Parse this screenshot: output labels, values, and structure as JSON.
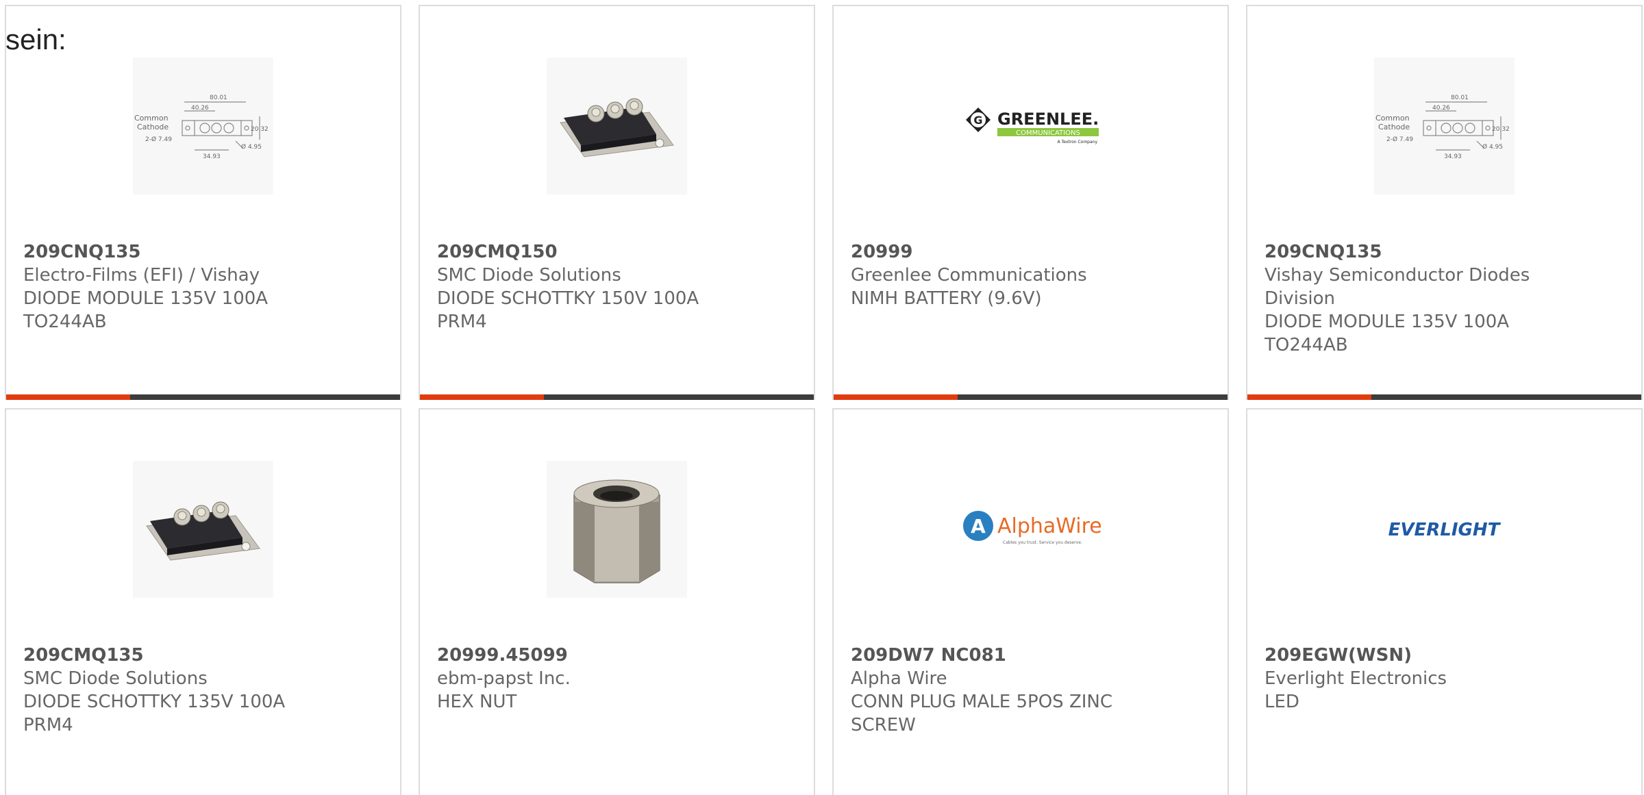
{
  "header": {
    "lead_text": "sein:"
  },
  "colors": {
    "accent": "#e03c10",
    "bar": "#3c3c3c",
    "border": "#dcdcdc",
    "text": "#666666"
  },
  "products": [
    {
      "part": "209CNQ135",
      "manufacturer": "Electro-Films (EFI) / Vishay",
      "desc1": "DIODE MODULE 135V 100A",
      "desc2": "TO244AB",
      "image": "dimension-drawing",
      "drawing": {
        "common": "Common",
        "cathode": "Cathode",
        "dim1": "80.01",
        "dim2": "40.26",
        "dim3": "20.32",
        "dim4": "2-Ø 7.49",
        "dim5": "Ø 4.95",
        "dim6": "34.93"
      }
    },
    {
      "part": "209CMQ150",
      "manufacturer": "SMC Diode Solutions",
      "desc1": "DIODE SCHOTTKY 150V 100A",
      "desc2": "PRM4",
      "image": "diode-module-photo"
    },
    {
      "part": "20999",
      "manufacturer": "Greenlee Communications",
      "desc1": "NIMH BATTERY (9.6V)",
      "desc2": "",
      "image": "greenlee-logo",
      "logo": {
        "name": "GREENLEE.",
        "sub": "COMMUNICATIONS",
        "tag": "A Textron Company",
        "mark": "G"
      }
    },
    {
      "part": "209CNQ135",
      "manufacturer": "Vishay Semiconductor Diodes Division",
      "desc1": "DIODE MODULE 135V 100A",
      "desc2": "TO244AB",
      "image": "dimension-drawing",
      "drawing": {
        "common": "Common",
        "cathode": "Cathode",
        "dim1": "80.01",
        "dim2": "40.26",
        "dim3": "20.32",
        "dim4": "2-Ø 7.49",
        "dim5": "Ø 4.95",
        "dim6": "34.93"
      }
    },
    {
      "part": "209CMQ135",
      "manufacturer": "SMC Diode Solutions",
      "desc1": "DIODE SCHOTTKY 135V 100A",
      "desc2": "PRM4",
      "image": "diode-module-photo"
    },
    {
      "part": "20999.45099",
      "manufacturer": "ebm-papst Inc.",
      "desc1": "HEX NUT",
      "desc2": "",
      "image": "hex-nut-photo"
    },
    {
      "part": "209DW7 NC081",
      "manufacturer": "Alpha Wire",
      "desc1": "CONN PLUG MALE 5POS ZINC SCREW",
      "desc2": "",
      "image": "alphawire-logo",
      "logo": {
        "name": "AlphaWire",
        "tag": "Cables you trust. Service you deserve.",
        "mark": "A"
      }
    },
    {
      "part": "209EGW(WSN)",
      "manufacturer": "Everlight Electronics",
      "desc1": "LED",
      "desc2": "",
      "image": "everlight-logo",
      "logo": {
        "name": "EVERLIGHT"
      }
    }
  ]
}
